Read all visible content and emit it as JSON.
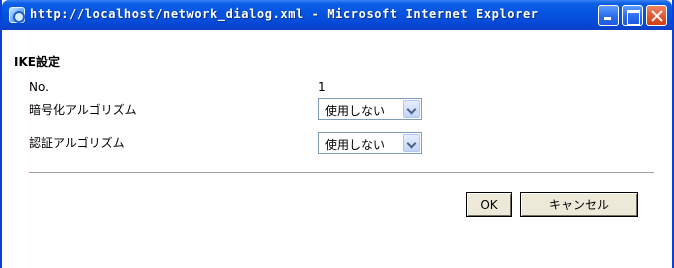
{
  "window": {
    "title": "http://localhost/network_dialog.xml - Microsoft Internet Explorer"
  },
  "dialog": {
    "section_title": "IKE設定",
    "rows": [
      {
        "label": "No.",
        "value": "1"
      },
      {
        "label": "暗号化アルゴリズム",
        "value": "使用しない"
      },
      {
        "label": "認証アルゴリズム",
        "value": "使用しない"
      }
    ],
    "ok_label": "OK",
    "cancel_label": "キャンセル"
  },
  "icons": {
    "window_icon": "ie-page-icon",
    "minimize": "minimize-icon",
    "maximize": "maximize-icon",
    "close": "close-icon"
  },
  "colors": {
    "titlebar": "#0553e0",
    "close_button": "#e4562e",
    "button_face": "#ece9d8",
    "select_border": "#7f9db9"
  }
}
